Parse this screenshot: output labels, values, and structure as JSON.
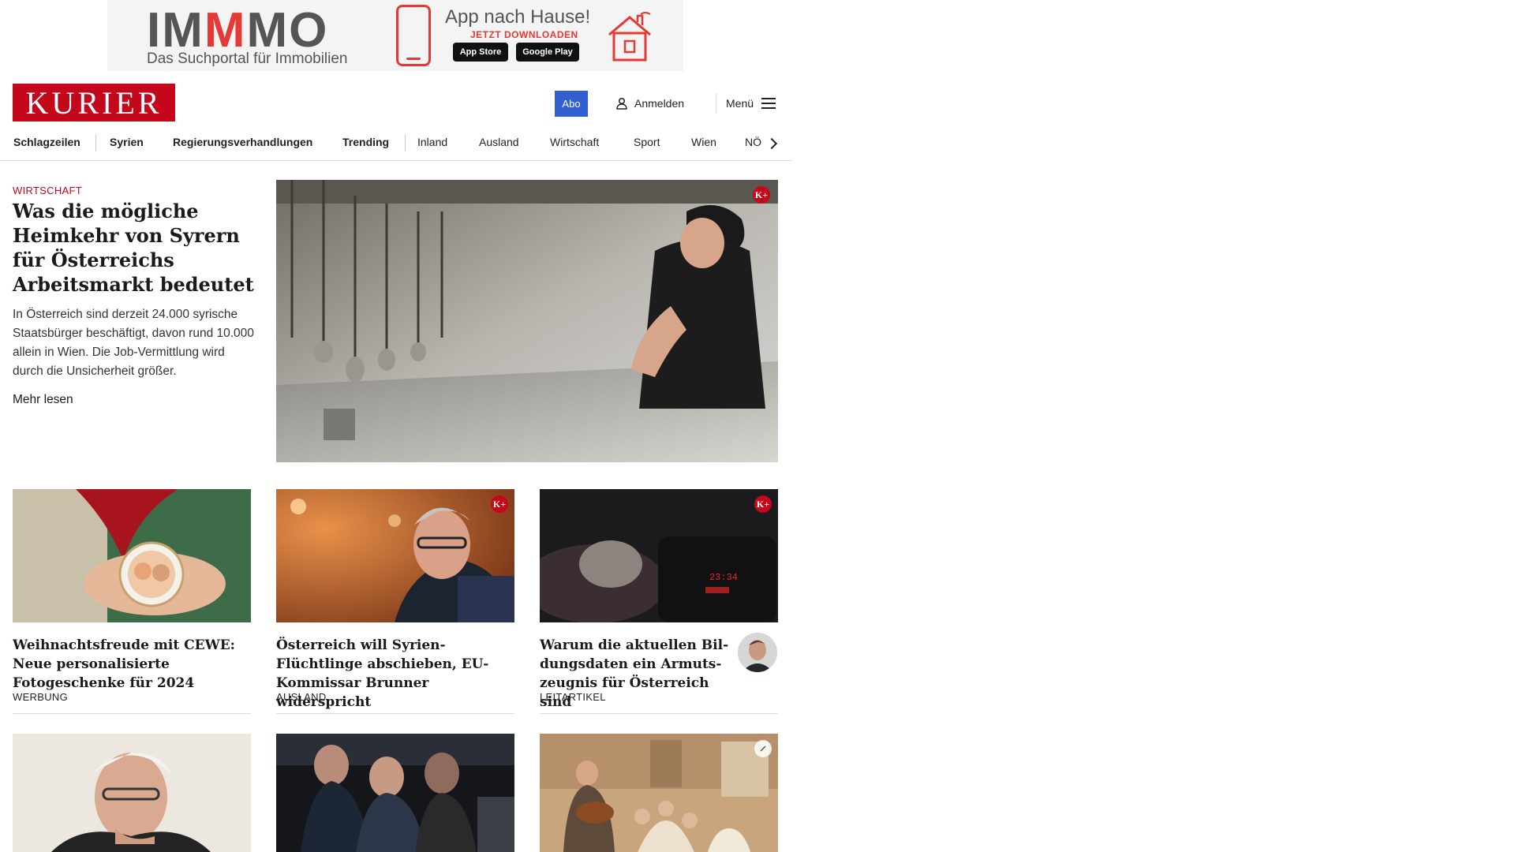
{
  "ad": {
    "logo_prefix": "IM",
    "logo_m": "M",
    "logo_suffix": "MO",
    "subtitle": "Das Suchportal für Immobilien",
    "headline": "App nach Hause!",
    "cta": "JETZT DOWNLOADEN",
    "store_apple": "App Store",
    "store_google": "Google Play"
  },
  "header": {
    "logo": "KURIER",
    "abo_label": "Abo",
    "login_label": "Anmelden",
    "menu_label": "Menü"
  },
  "nav": {
    "items": [
      "Schlagzeilen",
      "Syrien",
      "Regierungsverhandlungen",
      "Trending",
      "Inland",
      "Ausland",
      "Wirtschaft",
      "Sport",
      "Wien",
      "NÖ"
    ]
  },
  "hero": {
    "category": "WIRTSCHAFT",
    "title": "Was die mögliche Heim­kehr von Syrern für Ös­terreichs Arbeitsmarkt bedeutet",
    "teaser": "In Österreich sind derzeit 24.000 syrische Staatsbürger beschäftigt, davon rund 10.000 allein in Wien. Die Job-Vermittlung wird durch die Unsicherheit größer.",
    "more": "Mehr lesen",
    "badge": "K+"
  },
  "cards": [
    {
      "title": "Weihnachtsfreude mit CEWE: Neue personalisierte Fotogeschenke für 2024",
      "category": "WERBUNG"
    },
    {
      "title": "Österreich will Syrien-Flüchtlinge abschieben, EU-Kommissar Brun­ner widerspricht",
      "category": "AUSLAND",
      "badge": "K+"
    },
    {
      "title": "Warum die aktuellen Bil­dungsdaten ein Armuts­zeugnis für Österreich sind",
      "category": "LEITARTIKEL",
      "badge": "K+",
      "clock_text": "23:34"
    }
  ],
  "colors": {
    "brand_red": "#c4071b",
    "abo_blue": "#2f5fd0"
  }
}
